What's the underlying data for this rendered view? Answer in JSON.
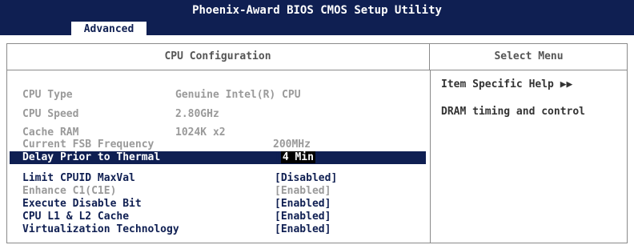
{
  "app": {
    "title": "Phoenix-Award BIOS CMOS Setup Utility"
  },
  "tabs": {
    "active": "Advanced"
  },
  "section": {
    "title": "CPU Configuration"
  },
  "sidebar": {
    "title": "Select Menu",
    "help_title": "Item Specific Help ▶▶",
    "help_text": "DRAM timing and control"
  },
  "info": {
    "cpu_type_label": "CPU Type",
    "cpu_type_value": "Genuine Intel(R) CPU",
    "cpu_speed_label": "CPU Speed",
    "cpu_speed_value": "2.80GHz",
    "cache_label": "Cache RAM",
    "cache_value": "1024K x2",
    "fsb_label": "Current FSB Frequency",
    "fsb_value": "200MHz"
  },
  "settings": {
    "delay_label": "Delay Prior to Thermal",
    "delay_value": "4 Min",
    "cpuid_label": "Limit CPUID MaxVal",
    "cpuid_value": "[Disabled]",
    "c1e_label": "Enhance C1(C1E)",
    "c1e_value": "[Enabled]",
    "xd_label": "Execute Disable Bit",
    "xd_value": "[Enabled]",
    "cache_label": "CPU L1 & L2 Cache",
    "cache_value": "[Enabled]",
    "vt_label": "Virtualization Technology",
    "vt_value": "[Enabled]"
  }
}
